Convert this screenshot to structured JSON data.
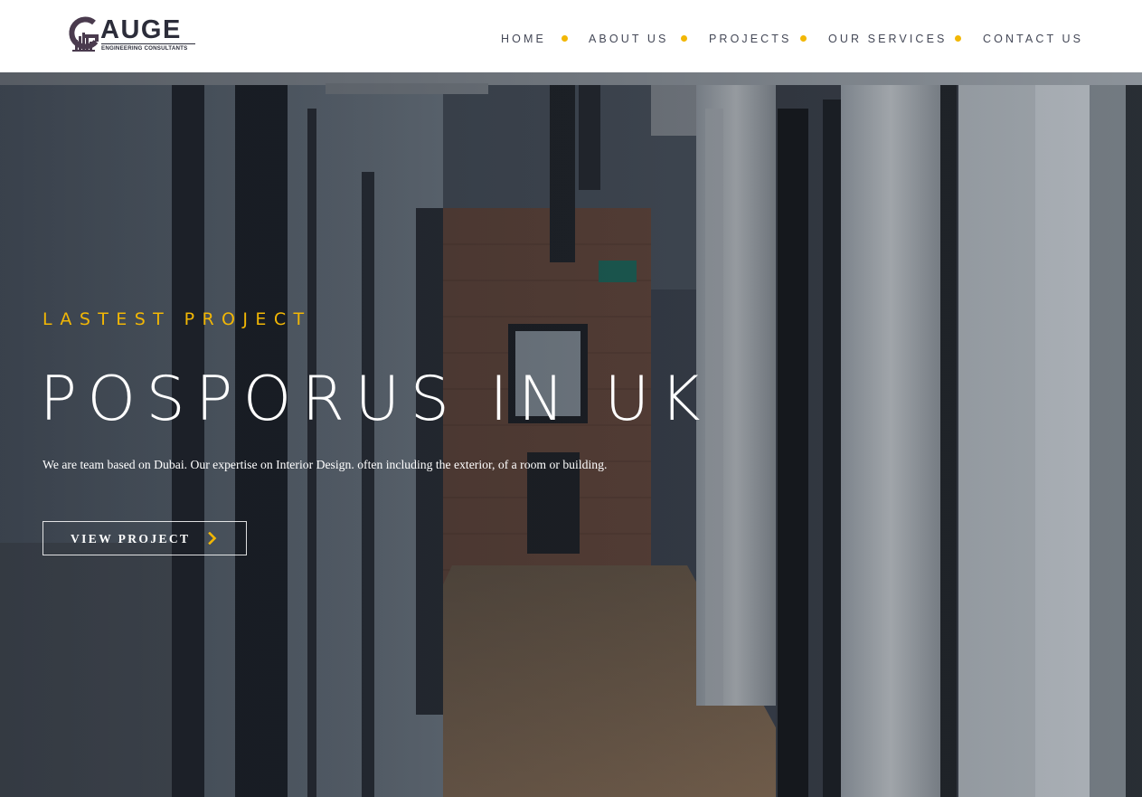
{
  "brand": {
    "name": "AUGE",
    "tagline": "ENGINEERING CONSULTANTS",
    "icon": "gauge-logo-icon"
  },
  "nav": {
    "items": [
      {
        "label": "HOME"
      },
      {
        "label": "ABOUT US"
      },
      {
        "label": "PROJECTS"
      },
      {
        "label": "OUR SERVICES"
      },
      {
        "label": "CONTACT US"
      }
    ],
    "separator_color": "#f2b705"
  },
  "hero": {
    "kicker": "LASTEST PROJECT",
    "title": "POSPORUS IN UK",
    "description": "We are team based on Dubai. Our expertise on Interior Design. often including the exterior, of a room or building.",
    "cta_label": "VIEW PROJECT",
    "cta_icon": "chevron-right-icon",
    "accent_color": "#f2b705"
  }
}
